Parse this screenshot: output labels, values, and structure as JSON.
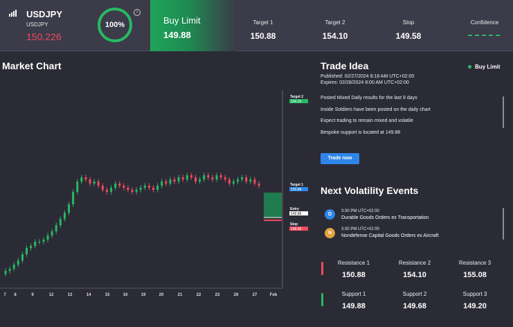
{
  "header": {
    "symbol": "USDJPY",
    "symbol_sub": "USDJPY",
    "price": "150.226",
    "confidence_ring": "100%",
    "order_type": "Buy Limit",
    "order_price": "149.88",
    "stats": [
      {
        "label": "Target 1",
        "value": "150.88"
      },
      {
        "label": "Target 2",
        "value": "154.10"
      },
      {
        "label": "Stop",
        "value": "149.58"
      },
      {
        "label": "Confidence",
        "value": ""
      }
    ],
    "colors": {
      "up": "#28b863",
      "down": "#ef4b5d",
      "accent": "#2f86e8"
    }
  },
  "chart": {
    "title": "Market Chart",
    "markers": {
      "target2": {
        "label": "Target 2",
        "value": "154.10"
      },
      "target1": {
        "label": "Target 1",
        "value": "150.88"
      },
      "entry": {
        "label": "Entry",
        "value": "149.88"
      },
      "stop": {
        "label": "Stop",
        "value": "149.58"
      }
    },
    "x_ticks": [
      "7",
      "8",
      "9",
      "12",
      "13",
      "14",
      "15",
      "16",
      "19",
      "20",
      "21",
      "22",
      "23",
      "26",
      "27",
      "Feb"
    ]
  },
  "chart_data": {
    "type": "candlestick",
    "series": [
      {
        "values": [
          146.1,
          146.2,
          146.4,
          146.6,
          146.9,
          147.2,
          147.3,
          147.5,
          147.5,
          147.6,
          147.8,
          148.0,
          148.3,
          148.6,
          148.9,
          149.3,
          149.9,
          150.4,
          150.6,
          150.5,
          150.3,
          150.4,
          150.2,
          150.0,
          149.9,
          150.1,
          150.3,
          150.2,
          150.1,
          150.0,
          149.9,
          150.0,
          150.1,
          150.2,
          150.1,
          150.0,
          150.2,
          150.4,
          150.3,
          150.5,
          150.4,
          150.6,
          150.5,
          150.7,
          150.6,
          150.4,
          150.5,
          150.7,
          150.6,
          150.5,
          150.7,
          150.6,
          150.5,
          150.3,
          150.4,
          150.5,
          150.6,
          150.4,
          150.5,
          150.3,
          150.2
        ]
      }
    ]
  },
  "trade_idea": {
    "title": "Trade Idea",
    "badge": "Buy Limit",
    "published": "Published: 02/27/2024 8:18 AM UTC+02:00",
    "expires": "Expires: 02/28/2024 8:00 AM UTC+02:00",
    "lines": [
      "Posted Mixed Daily results for the last 9 days",
      "Inside Soldiers have been posted on the daily chart",
      "Expect trading to remain mixed and volatile",
      "Bespoke support is located at 149.88"
    ],
    "button": "Trade now"
  },
  "volatility": {
    "title": "Next Volatility Events",
    "events": [
      {
        "icon": "D",
        "color": "#2f86e8",
        "time": "3:30 PM UTC+02:00",
        "name": "Durable Goods Orders ex Transportation"
      },
      {
        "icon": "N",
        "color": "#e2a33a",
        "time": "3:30 PM UTC+02:00",
        "name": "Nondefense Capital Goods Orders ex Aircraft"
      }
    ]
  },
  "levels": {
    "resistance": [
      {
        "label": "Resistance 1",
        "value": "150.88"
      },
      {
        "label": "Resistance 2",
        "value": "154.10"
      },
      {
        "label": "Resistance 3",
        "value": "155.08"
      }
    ],
    "support": [
      {
        "label": "Support 1",
        "value": "149.88"
      },
      {
        "label": "Support 2",
        "value": "149.68"
      },
      {
        "label": "Support 3",
        "value": "149.20"
      }
    ]
  }
}
